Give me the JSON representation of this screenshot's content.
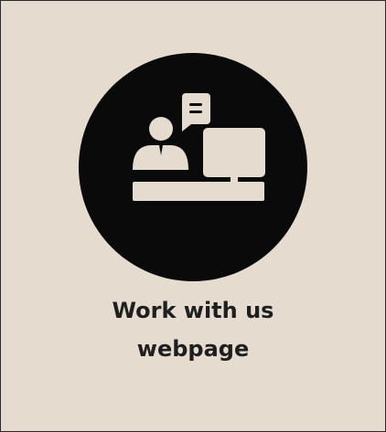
{
  "card": {
    "label_line1": "Work with us",
    "label_line2": "webpage",
    "icon": "person-at-computer-chat-icon",
    "colors": {
      "background": "#e5dccf",
      "icon_circle": "#0a0a0a",
      "icon_glyph": "#e5dccf",
      "text": "#1f1f1f",
      "border": "#2a2a2a"
    }
  }
}
